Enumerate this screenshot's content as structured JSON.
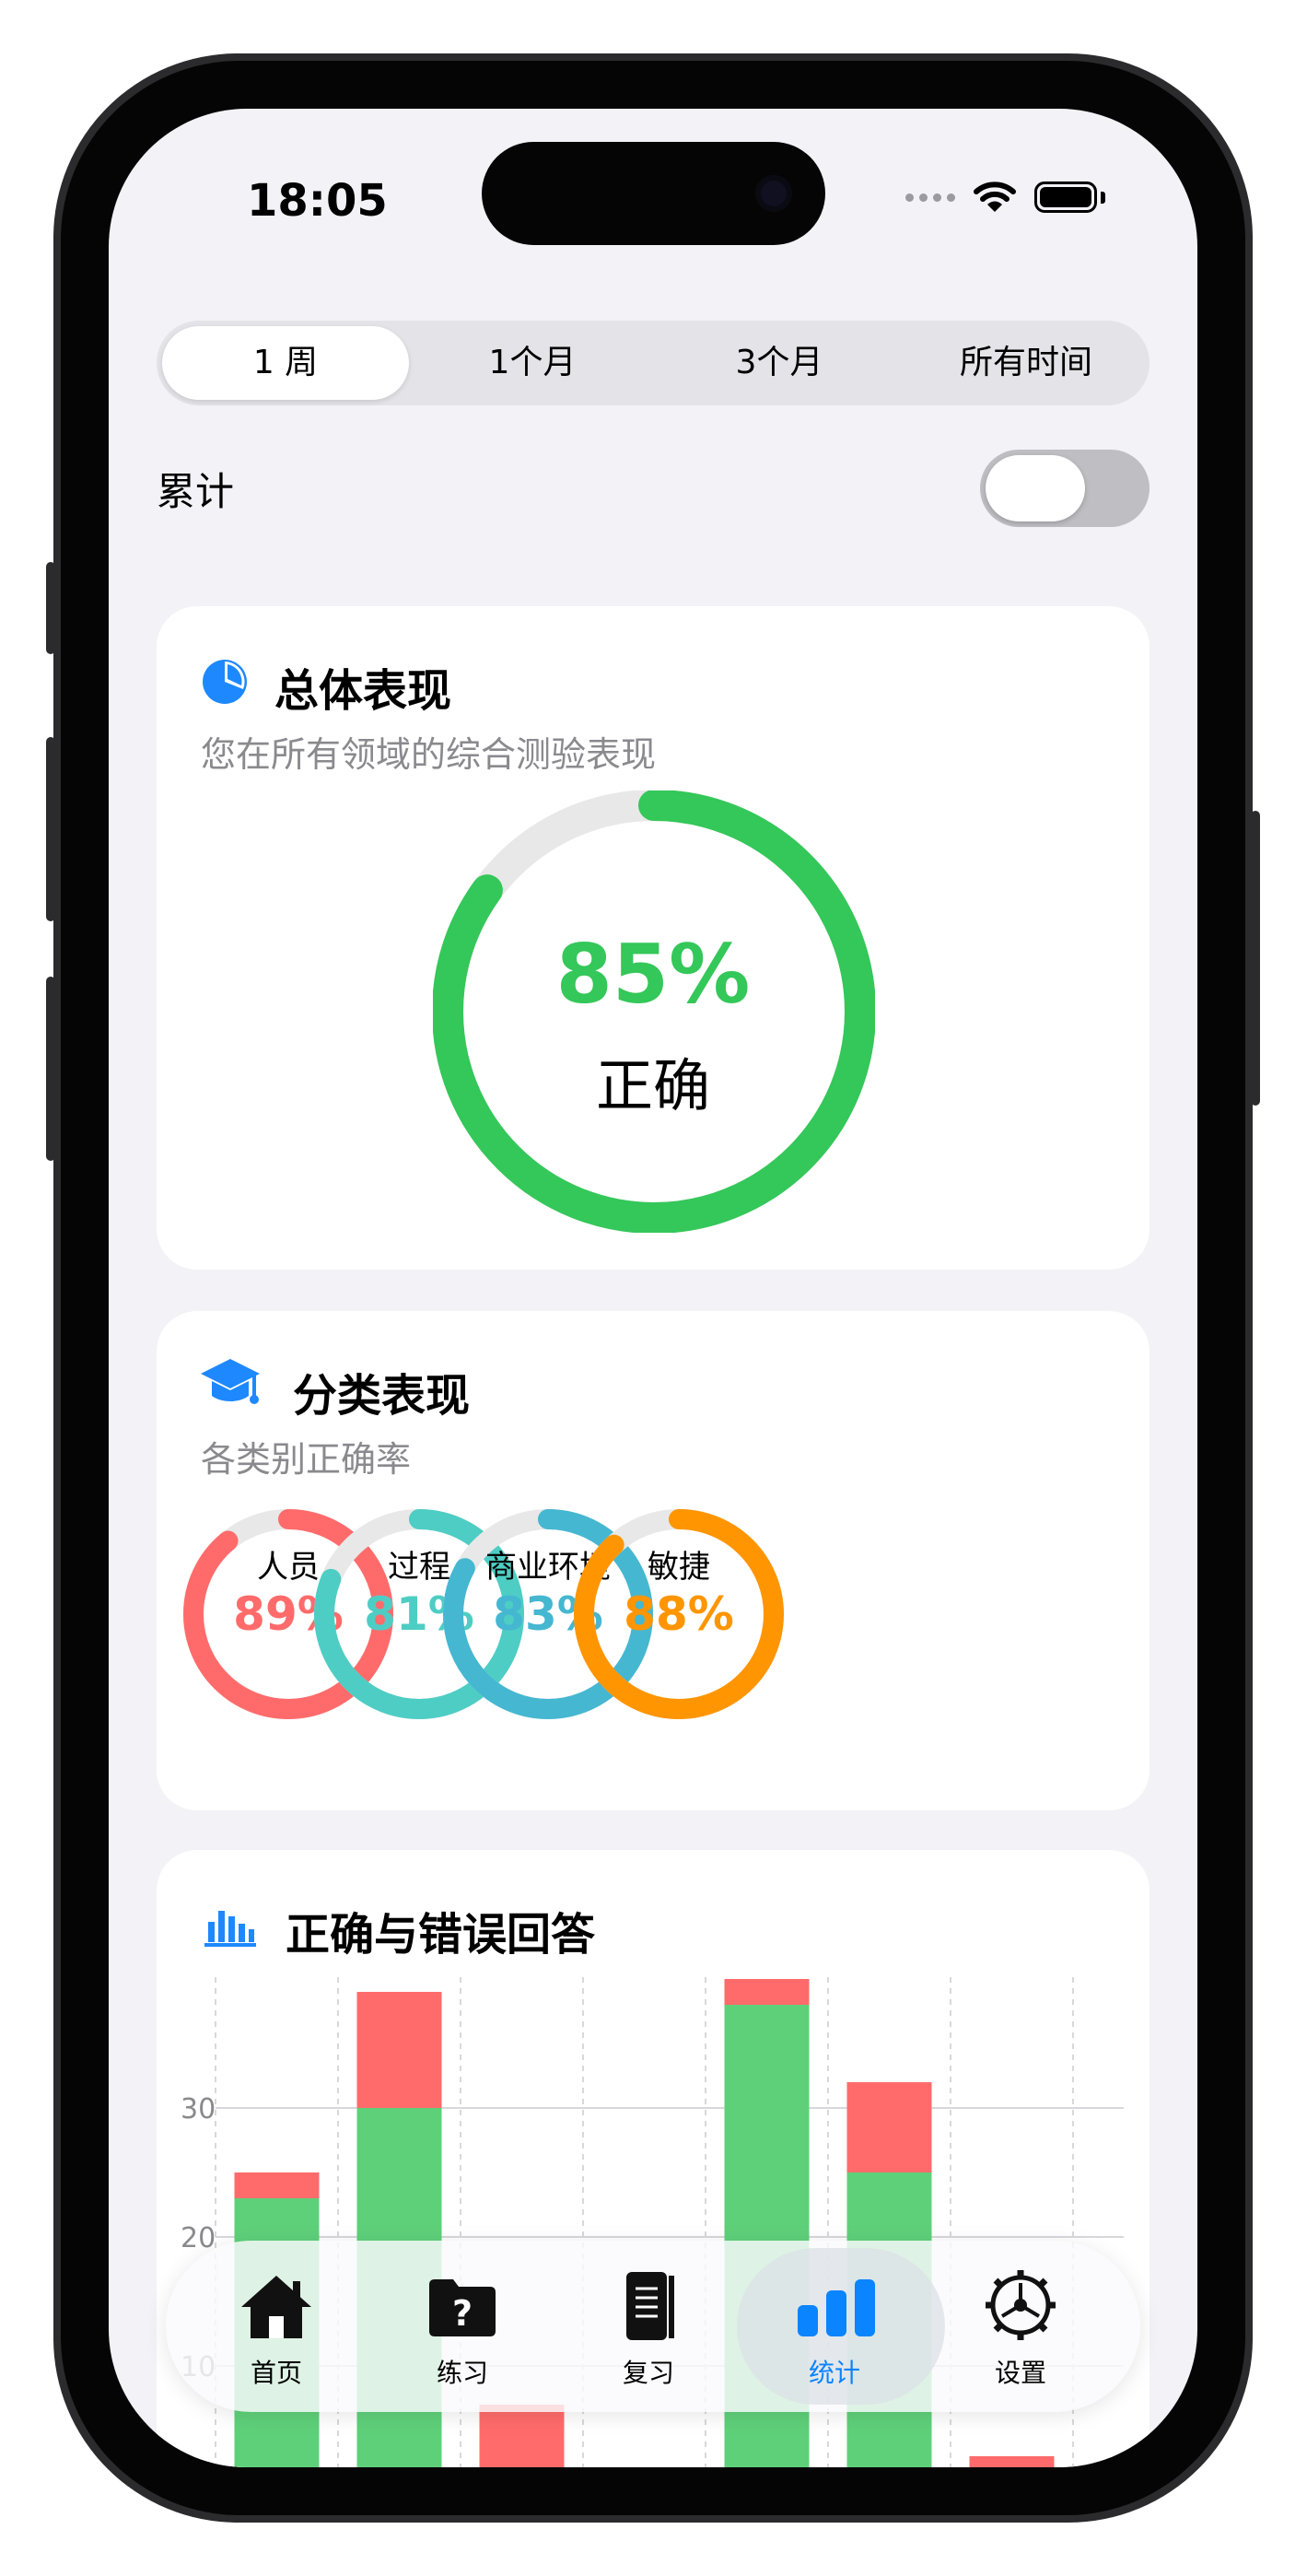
{
  "status_bar": {
    "time": "18:05"
  },
  "segmented": {
    "items": [
      "1 周",
      "1个月",
      "3个月",
      "所有时间"
    ],
    "selected": "1 周"
  },
  "cumulative": {
    "label": "累计",
    "on": false
  },
  "overall": {
    "title": "总体表现",
    "subtitle": "您在所有领域的综合测验表现",
    "percent": 85,
    "percent_text": "85%",
    "label": "正确",
    "color": "#34c759"
  },
  "categories": {
    "title": "分类表现",
    "subtitle": "各类别正确率",
    "items": [
      {
        "name": "人员",
        "percent": 89,
        "percent_text": "89%",
        "color": "#ff6b6b"
      },
      {
        "name": "过程",
        "percent": 81,
        "percent_text": "81%",
        "color": "#4ecdc4"
      },
      {
        "name": "商业环境",
        "percent": 83,
        "percent_text": "83%",
        "color": "#45b7d1"
      },
      {
        "name": "敏捷",
        "percent": 88,
        "percent_text": "88%",
        "color": "#ff9500"
      }
    ]
  },
  "answers_chart": {
    "title": "正确与错误回答"
  },
  "chart_data": {
    "type": "bar",
    "stacked": true,
    "y_ticks": [
      "30",
      "20",
      "10"
    ],
    "ylim": [
      0,
      39
    ],
    "grid": true,
    "series": [
      {
        "color": "#5fd07a",
        "values": [
          23,
          30,
          0,
          0,
          38,
          25,
          0
        ]
      },
      {
        "color": "#ff6b6b",
        "values": [
          2,
          9,
          7,
          1,
          2,
          7,
          3
        ]
      }
    ]
  },
  "tabbar": {
    "items": [
      {
        "label": "首页",
        "icon": "house-icon"
      },
      {
        "label": "练习",
        "icon": "question-folder-icon"
      },
      {
        "label": "复习",
        "icon": "book-icon"
      },
      {
        "label": "统计",
        "icon": "bar-chart-icon"
      },
      {
        "label": "设置",
        "icon": "gear-icon"
      }
    ],
    "selected": "统计",
    "accent": "#0a84ff"
  }
}
